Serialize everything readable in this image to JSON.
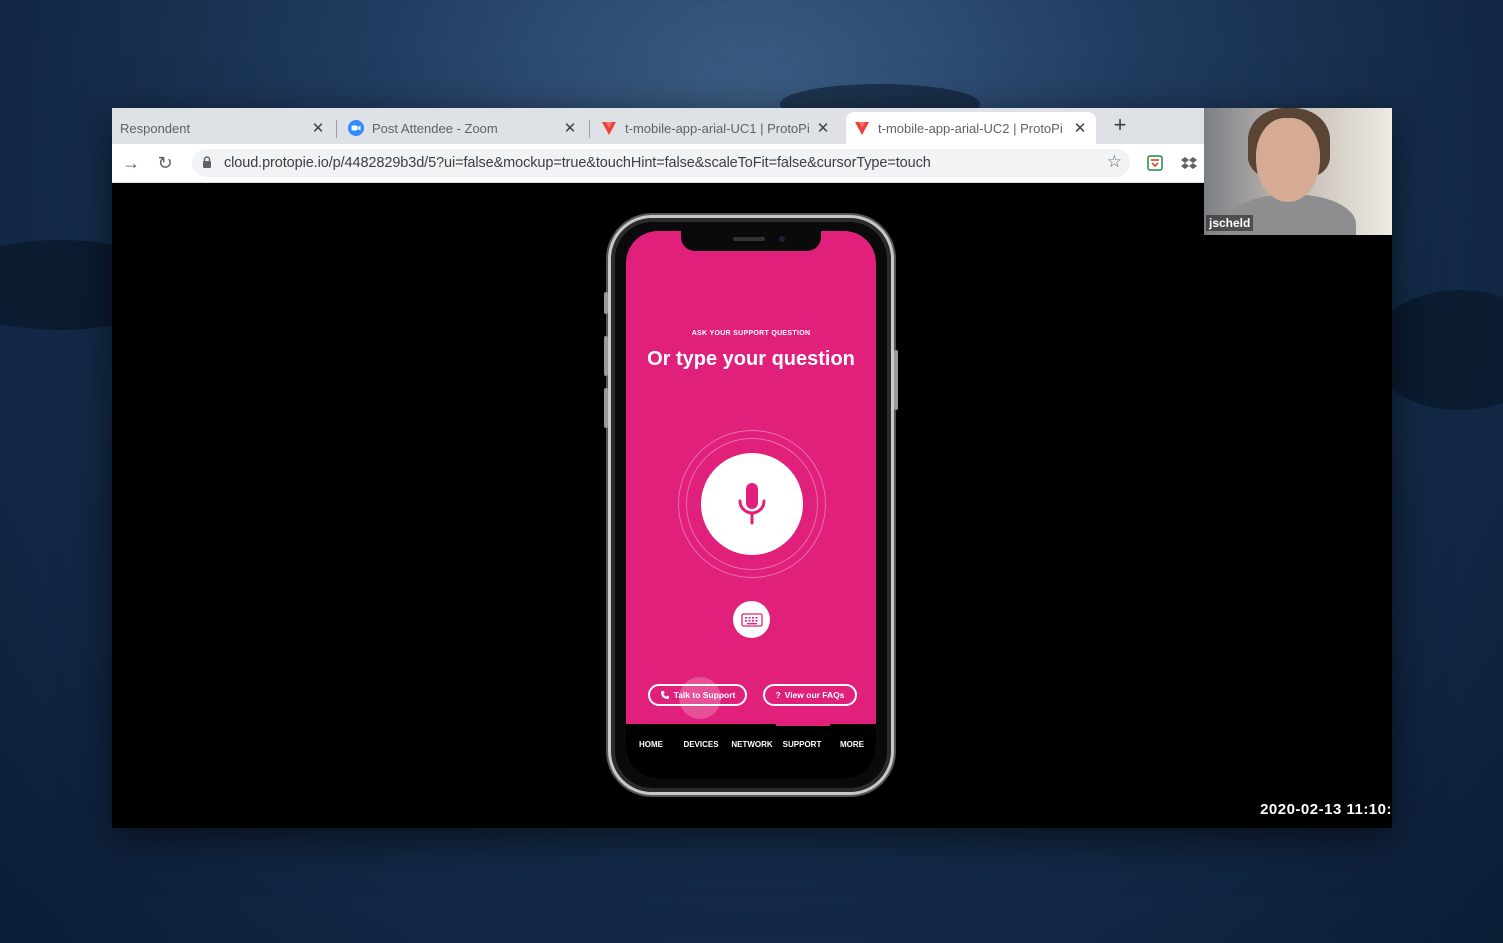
{
  "browser": {
    "tabs": [
      {
        "title": "Respondent",
        "icon": "none"
      },
      {
        "title": "Post Attendee - Zoom",
        "icon": "zoom-icon"
      },
      {
        "title": "t-mobile-app-arial-UC1 | ProtoPi",
        "icon": "protopie-icon"
      },
      {
        "title": "t-mobile-app-arial-UC2 | ProtoPi",
        "icon": "protopie-icon",
        "active": true
      }
    ],
    "new_tab_label": "+",
    "url": "cloud.protopie.io/p/4482829b3d/5?ui=false&mockup=true&touchHint=false&scaleToFit=false&cursorType=touch"
  },
  "video": {
    "participant_name": "jscheld"
  },
  "timestamp": "2020-02-13  11:10:",
  "app": {
    "eyebrow": "ASK YOUR SUPPORT QUESTION",
    "headline": "Or type your question",
    "buttons": {
      "talk": "Talk to Support",
      "faqs": "View our FAQs",
      "faqs_icon_glyph": "?"
    },
    "nav": [
      "HOME",
      "DEVICES",
      "NETWORK",
      "SUPPORT",
      "MORE"
    ],
    "colors": {
      "brand": "#e0207a",
      "nav_bg": "#000000"
    }
  }
}
